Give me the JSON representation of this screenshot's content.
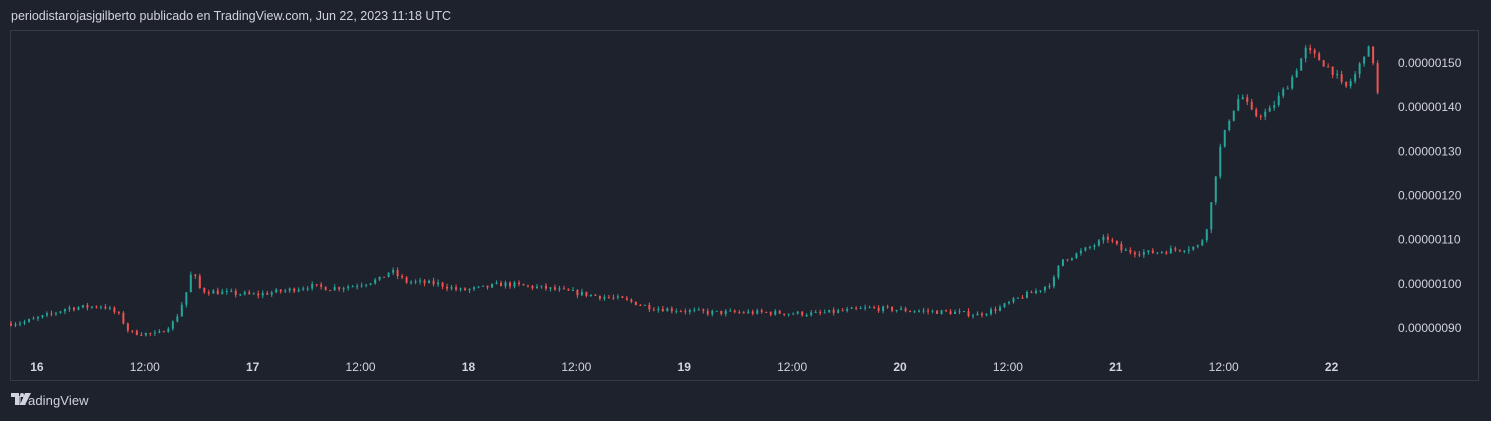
{
  "header": {
    "attribution": "periodistarojasjgilberto publicado en TradingView.com, Jun 22, 2023 11:18 UTC"
  },
  "footer": {
    "brand": "TradingView"
  },
  "colors": {
    "background": "#1e222d",
    "up": "#26a69a",
    "down": "#ef5350",
    "axis_text": "#d1d4dc",
    "border": "#363a45"
  },
  "chart_data": {
    "type": "candlestick",
    "title": "",
    "xlabel": "",
    "ylabel": "",
    "ylim": [
      8.5e-07,
      1.575e-06
    ],
    "y_ticks": [
      "0.00000090",
      "0.00000100",
      "0.00000110",
      "0.00000120",
      "0.00000130",
      "0.00000140",
      "0.00000150"
    ],
    "x_ticks": [
      {
        "label": "16",
        "bold": true
      },
      {
        "label": "12:00",
        "bold": false
      },
      {
        "label": "17",
        "bold": true
      },
      {
        "label": "12:00",
        "bold": false
      },
      {
        "label": "18",
        "bold": true
      },
      {
        "label": "12:00",
        "bold": false
      },
      {
        "label": "19",
        "bold": true
      },
      {
        "label": "12:00",
        "bold": false
      },
      {
        "label": "20",
        "bold": true
      },
      {
        "label": "12:00",
        "bold": false
      },
      {
        "label": "21",
        "bold": true
      },
      {
        "label": "12:00",
        "bold": false
      },
      {
        "label": "22",
        "bold": true
      }
    ],
    "x_tick_days": [
      0.12,
      0.62,
      1.12,
      1.62,
      2.12,
      2.62,
      3.12,
      3.62,
      4.12,
      4.62,
      5.12,
      5.62,
      6.12
    ],
    "grid": false,
    "price_path": [
      [
        0.0,
        9.1e-07
      ],
      [
        0.08,
        9.13e-07
      ],
      [
        0.2,
        9.3e-07
      ],
      [
        0.28,
        9.45e-07
      ],
      [
        0.45,
        9.5e-07
      ],
      [
        0.52,
        9.3e-07
      ],
      [
        0.57,
        8.9e-07
      ],
      [
        0.7,
        8.85e-07
      ],
      [
        0.78,
        9.15e-07
      ],
      [
        0.83,
        9.75e-07
      ],
      [
        0.86,
        1.03e-06
      ],
      [
        0.9,
        9.85e-07
      ],
      [
        1.0,
        9.8e-07
      ],
      [
        1.15,
        9.75e-07
      ],
      [
        1.3,
        9.85e-07
      ],
      [
        1.4,
        9.95e-07
      ],
      [
        1.5,
        9.9e-07
      ],
      [
        1.6,
        9.95e-07
      ],
      [
        1.73,
        1.01e-06
      ],
      [
        1.78,
        1.03e-06
      ],
      [
        1.85,
        1.005e-06
      ],
      [
        2.0,
        1e-06
      ],
      [
        2.1,
        9.85e-07
      ],
      [
        2.2,
        9.9e-07
      ],
      [
        2.3,
        1e-06
      ],
      [
        2.5,
        9.9e-07
      ],
      [
        2.7,
        9.75e-07
      ],
      [
        2.85,
        9.65e-07
      ],
      [
        3.0,
        9.45e-07
      ],
      [
        3.25,
        9.35e-07
      ],
      [
        3.5,
        9.35e-07
      ],
      [
        3.75,
        9.32e-07
      ],
      [
        4.0,
        9.45e-07
      ],
      [
        4.25,
        9.38e-07
      ],
      [
        4.4,
        9.35e-07
      ],
      [
        4.5,
        9.3e-07
      ],
      [
        4.6,
        9.45e-07
      ],
      [
        4.7,
        9.7e-07
      ],
      [
        4.78,
        9.85e-07
      ],
      [
        4.85,
        1.005e-06
      ],
      [
        4.89,
        1.055e-06
      ],
      [
        4.95,
        1.065e-06
      ],
      [
        5.05,
        1.09e-06
      ],
      [
        5.1,
        1.105e-06
      ],
      [
        5.17,
        1.075e-06
      ],
      [
        5.3,
        1.07e-06
      ],
      [
        5.45,
        1.08e-06
      ],
      [
        5.53,
        1.085e-06
      ],
      [
        5.57,
        1.14e-06
      ],
      [
        5.62,
        1.3e-06
      ],
      [
        5.67,
        1.38e-06
      ],
      [
        5.72,
        1.43e-06
      ],
      [
        5.78,
        1.38e-06
      ],
      [
        5.85,
        1.39e-06
      ],
      [
        5.95,
        1.46e-06
      ],
      [
        6.02,
        1.53e-06
      ],
      [
        6.08,
        1.51e-06
      ],
      [
        6.15,
        1.48e-06
      ],
      [
        6.2,
        1.44e-06
      ],
      [
        6.26,
        1.48e-06
      ],
      [
        6.3,
        1.535e-06
      ],
      [
        6.33,
        1.52e-06
      ],
      [
        6.35,
        1.43e-06
      ]
    ]
  }
}
